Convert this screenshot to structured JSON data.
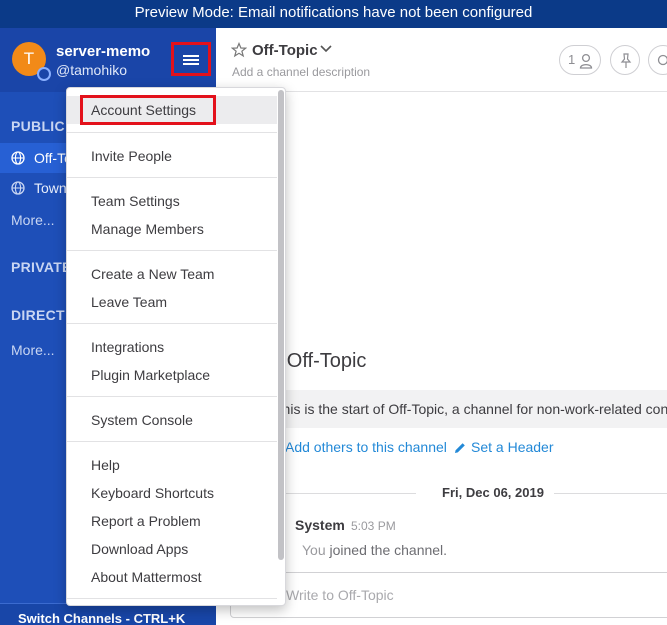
{
  "banner": {
    "text": "Preview Mode: Email notifications have not been configured"
  },
  "sidebar": {
    "avatar_initial": "T",
    "team_name": "server-memo",
    "username": "@tamohiko",
    "public_section": "PUBLIC CHANNELS",
    "public_channels": [
      "Off-Topic",
      "Town Square"
    ],
    "public_more": "More...",
    "private_section": "PRIVATE",
    "direct_section": "DIRECT MESSAGES",
    "direct_more": "More...",
    "switch_channels": "Switch Channels - CTRL+K"
  },
  "channel_header": {
    "name": "Off-Topic",
    "description_placeholder": "Add a channel description",
    "member_count": "1"
  },
  "intro": {
    "title": "Beginning of Off-Topic",
    "text": "This is the start of Off-Topic, a channel for non-work-related conversations.",
    "add_others": "Add others to this channel",
    "set_header": "Set a Header"
  },
  "date_separator": "Fri, Dec 06, 2019",
  "post": {
    "user": "System",
    "time": "5:03 PM",
    "msg_prefix": "You",
    "msg_bold": "joined the channel."
  },
  "composer": {
    "placeholder": "Write to Off-Topic"
  },
  "menu": {
    "items": [
      "Account Settings",
      "Invite People",
      "Team Settings",
      "Manage Members",
      "Create a New Team",
      "Leave Team",
      "Integrations",
      "Plugin Marketplace",
      "System Console",
      "Help",
      "Keyboard Shortcuts",
      "Report a Problem",
      "Download Apps",
      "About Mattermost"
    ]
  },
  "colors": {
    "banner": "#0b3a88",
    "sidebar": "#1e4fb8",
    "accent_link": "#2389d7",
    "highlight_box": "#e3111b",
    "avatar": "#f28a18"
  }
}
